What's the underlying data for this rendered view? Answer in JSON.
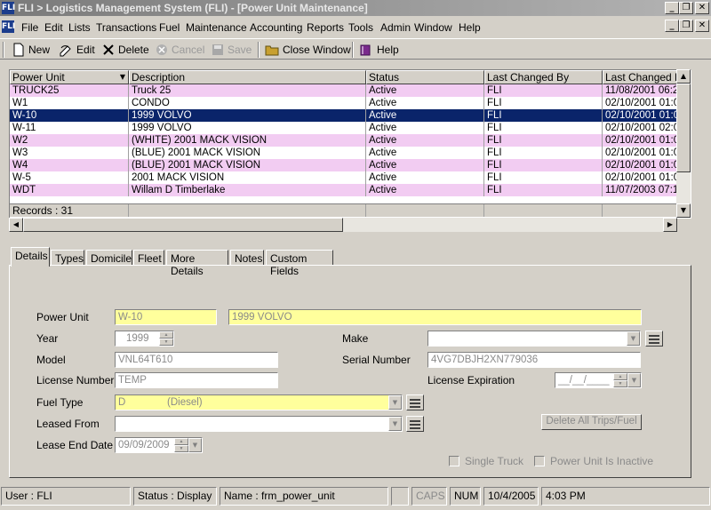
{
  "window": {
    "title": "FLI > Logistics Management System (FLI) - [Power Unit Maintenance]",
    "app_icon_text": "FLI"
  },
  "menu": [
    "File",
    "Edit",
    "Lists",
    "Transactions",
    "Fuel",
    "Maintenance",
    "Accounting",
    "Reports",
    "Tools",
    "Admin",
    "Window",
    "Help"
  ],
  "toolbar": {
    "new": "New",
    "edit": "Edit",
    "delete": "Delete",
    "cancel": "Cancel",
    "save": "Save",
    "close_window": "Close Window",
    "help": "Help"
  },
  "grid": {
    "columns": [
      "Power Unit",
      "Description",
      "Status",
      "Last Changed By",
      "Last Changed Da"
    ],
    "rows": [
      {
        "unit": "TRUCK25",
        "desc": "Truck 25",
        "status": "Active",
        "by": "FLI",
        "date": "11/08/2001 06:2"
      },
      {
        "unit": "W1",
        "desc": "CONDO",
        "status": "Active",
        "by": "FLI",
        "date": "02/10/2001 01:0"
      },
      {
        "unit": "W-10",
        "desc": "1999 VOLVO",
        "status": "Active",
        "by": "FLI",
        "date": "02/10/2001 01:0"
      },
      {
        "unit": "W-11",
        "desc": "1999 VOLVO",
        "status": "Active",
        "by": "FLI",
        "date": "02/10/2001 02:0"
      },
      {
        "unit": "W2",
        "desc": "(WHITE) 2001 MACK VISION",
        "status": "Active",
        "by": "FLI",
        "date": "02/10/2001 01:0"
      },
      {
        "unit": "W3",
        "desc": "(BLUE) 2001 MACK VISION",
        "status": "Active",
        "by": "FLI",
        "date": "02/10/2001 01:0"
      },
      {
        "unit": "W4",
        "desc": "(BLUE) 2001 MACK VISION",
        "status": "Active",
        "by": "FLI",
        "date": "02/10/2001 01:0"
      },
      {
        "unit": "W-5",
        "desc": "2001 MACK VISION",
        "status": "Active",
        "by": "FLI",
        "date": "02/10/2001 01:0"
      },
      {
        "unit": "WDT",
        "desc": "Willam D Timberlake",
        "status": "Active",
        "by": "FLI",
        "date": "11/07/2003 07:1"
      }
    ],
    "records": "Records : 31"
  },
  "tabs": [
    "Details",
    "Types",
    "Domicile",
    "Fleet",
    "More Details",
    "Notes",
    "Custom Fields"
  ],
  "form": {
    "power_unit_label": "Power Unit",
    "power_unit": "W-10",
    "description": "1999 VOLVO",
    "year_label": "Year",
    "year": "1999",
    "make_label": "Make",
    "make": "",
    "model_label": "Model",
    "model": "VNL64T610",
    "serial_label": "Serial Number",
    "serial": "4VG7DBJH2XN779036",
    "license_label": "License Number",
    "license": "TEMP",
    "license_exp_label": "License Expiration",
    "license_exp": "__/__/____",
    "fuel_type_label": "Fuel Type",
    "fuel_code": "D",
    "fuel_name": "(Diesel)",
    "leased_from_label": "Leased From",
    "leased_from": "",
    "lease_end_label": "Lease End Date",
    "lease_end": "09/09/2009",
    "delete_trips": "Delete All Trips/Fuel",
    "single_truck": "Single Truck",
    "inactive": "Power Unit Is Inactive"
  },
  "status": {
    "user": "User : FLI",
    "mode": "Status : Display",
    "name": "Name : frm_power_unit",
    "caps": "CAPS",
    "num": "NUM",
    "date": "10/4/2005",
    "time": "4:03 PM"
  },
  "colors": {
    "row_pink": "#f2ccf2",
    "selected": "#0a246a",
    "required_field": "#ffff9c"
  }
}
